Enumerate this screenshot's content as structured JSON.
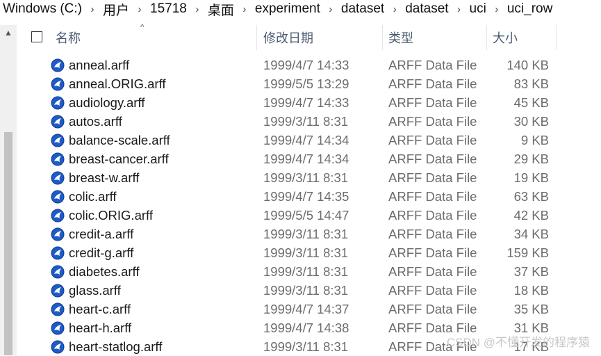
{
  "breadcrumb": {
    "items": [
      "Windows (C:)",
      "用户",
      "15718",
      "桌面",
      "experiment",
      "dataset",
      "dataset",
      "uci",
      "uci_row"
    ],
    "separator_icon": "chevron-right-icon"
  },
  "header": {
    "name": "名称",
    "date": "修改日期",
    "type": "类型",
    "size": "大小",
    "sort_indicator": "^"
  },
  "files": [
    {
      "name": "anneal.arff",
      "date": "1999/4/7 14:33",
      "type": "ARFF Data File",
      "size": "140 KB"
    },
    {
      "name": "anneal.ORIG.arff",
      "date": "1999/5/5 13:29",
      "type": "ARFF Data File",
      "size": "83 KB"
    },
    {
      "name": "audiology.arff",
      "date": "1999/4/7 14:33",
      "type": "ARFF Data File",
      "size": "45 KB"
    },
    {
      "name": "autos.arff",
      "date": "1999/3/11 8:31",
      "type": "ARFF Data File",
      "size": "30 KB"
    },
    {
      "name": "balance-scale.arff",
      "date": "1999/4/7 14:34",
      "type": "ARFF Data File",
      "size": "9 KB"
    },
    {
      "name": "breast-cancer.arff",
      "date": "1999/4/7 14:34",
      "type": "ARFF Data File",
      "size": "29 KB"
    },
    {
      "name": "breast-w.arff",
      "date": "1999/3/11 8:31",
      "type": "ARFF Data File",
      "size": "19 KB"
    },
    {
      "name": "colic.arff",
      "date": "1999/4/7 14:35",
      "type": "ARFF Data File",
      "size": "63 KB"
    },
    {
      "name": "colic.ORIG.arff",
      "date": "1999/5/5 14:47",
      "type": "ARFF Data File",
      "size": "42 KB"
    },
    {
      "name": "credit-a.arff",
      "date": "1999/3/11 8:31",
      "type": "ARFF Data File",
      "size": "34 KB"
    },
    {
      "name": "credit-g.arff",
      "date": "1999/3/11 8:31",
      "type": "ARFF Data File",
      "size": "159 KB"
    },
    {
      "name": "diabetes.arff",
      "date": "1999/3/11 8:31",
      "type": "ARFF Data File",
      "size": "37 KB"
    },
    {
      "name": "glass.arff",
      "date": "1999/3/11 8:31",
      "type": "ARFF Data File",
      "size": "18 KB"
    },
    {
      "name": "heart-c.arff",
      "date": "1999/4/7 14:37",
      "type": "ARFF Data File",
      "size": "35 KB"
    },
    {
      "name": "heart-h.arff",
      "date": "1999/4/7 14:38",
      "type": "ARFF Data File",
      "size": "31 KB"
    },
    {
      "name": "heart-statlog.arff",
      "date": "1999/3/11 8:31",
      "type": "ARFF Data File",
      "size": "17 KB"
    }
  ],
  "file_icon": "weka-bird-icon",
  "watermark": "CSDN @不懂开发的程序猿",
  "colors": {
    "icon_blue": "#1e5bc6",
    "secondary_text": "#6d6d6d",
    "header_text": "#4a5a70"
  }
}
